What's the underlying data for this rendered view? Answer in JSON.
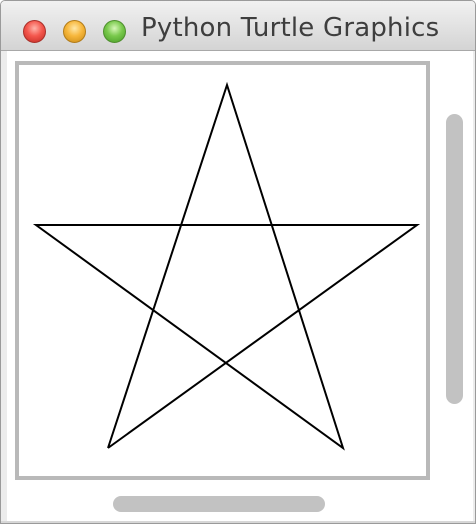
{
  "window": {
    "title": "Python Turtle Graphics",
    "buttons": {
      "close": {
        "color": "#f4574d"
      },
      "minimize": {
        "color": "#f7b73c"
      },
      "zoom": {
        "color": "#79c94c"
      }
    }
  },
  "canvas": {
    "background": "#ffffff",
    "drawing": "five-pointed star outline",
    "stroke_color": "#000000"
  }
}
